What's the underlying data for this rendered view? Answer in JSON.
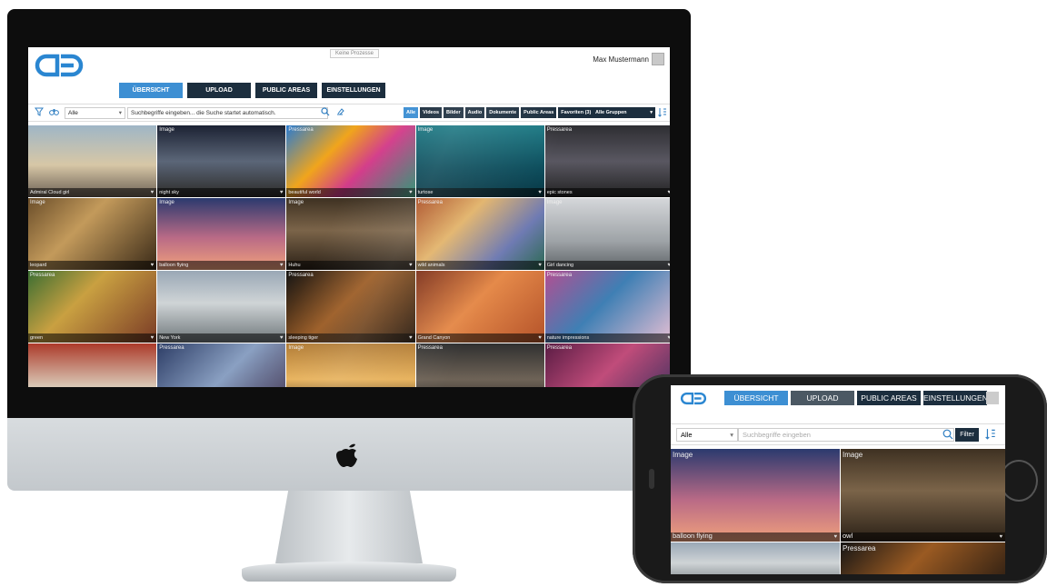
{
  "desktop": {
    "process_label": "Keine Prozesse",
    "user_name": "Max Mustermann",
    "nav": [
      {
        "label": "ÜBERSICHT"
      },
      {
        "label": "UPLOAD"
      },
      {
        "label": "PUBLIC AREAS"
      },
      {
        "label": "EINSTELLUNGEN"
      }
    ],
    "toolbar": {
      "category_select": "Alle",
      "search_placeholder": "Suchbegriffe eingeben... die Suche startet automatisch.",
      "filters": [
        "Alle",
        "Videos",
        "Bilder",
        "Audio",
        "Dokumente",
        "Public Areas",
        "Favoriten (3)"
      ],
      "group_select": "Alle Gruppen"
    },
    "tiles": [
      {
        "tag": "",
        "caption": "Admiral Cloud girl"
      },
      {
        "tag": "Image",
        "caption": "night sky"
      },
      {
        "tag": "Pressarea",
        "caption": "beautiful world"
      },
      {
        "tag": "Image",
        "caption": "turtose"
      },
      {
        "tag": "Pressarea",
        "caption": "epic stones"
      },
      {
        "tag": "Image",
        "caption": "leopard"
      },
      {
        "tag": "Image",
        "caption": "balloon flying"
      },
      {
        "tag": "Image",
        "caption": "Huhu"
      },
      {
        "tag": "Pressarea",
        "caption": "wild animals"
      },
      {
        "tag": "Image",
        "caption": "Girl dancing"
      },
      {
        "tag": "Pressarea",
        "caption": "green"
      },
      {
        "tag": "",
        "caption": "New York"
      },
      {
        "tag": "Pressarea",
        "caption": "sleeping tiger"
      },
      {
        "tag": "",
        "caption": "Grand Canyon"
      },
      {
        "tag": "Pressarea",
        "caption": "nature impressions"
      },
      {
        "tag": "",
        "caption": ""
      },
      {
        "tag": "Pressarea",
        "caption": ""
      },
      {
        "tag": "Image",
        "caption": ""
      },
      {
        "tag": "Pressarea",
        "caption": ""
      },
      {
        "tag": "Pressarea",
        "caption": ""
      }
    ]
  },
  "mobile": {
    "nav": [
      {
        "label": "ÜBERSICHT"
      },
      {
        "label": "UPLOAD"
      },
      {
        "label": "PUBLIC AREAS"
      },
      {
        "label": "EINSTELLUNGEN"
      }
    ],
    "category_select": "Alle",
    "search_placeholder": "Suchbegriffe eingeben",
    "filter_label": "Filter",
    "tiles": [
      {
        "tag": "Image",
        "caption": "balloon flying"
      },
      {
        "tag": "Image",
        "caption": "owl"
      },
      {
        "tag": "",
        "caption": ""
      },
      {
        "tag": "Pressarea",
        "caption": ""
      }
    ]
  },
  "colors": {
    "accent": "#3d8fd3",
    "nav_dark": "#1c2e3e",
    "logo": "#2a86d1"
  }
}
